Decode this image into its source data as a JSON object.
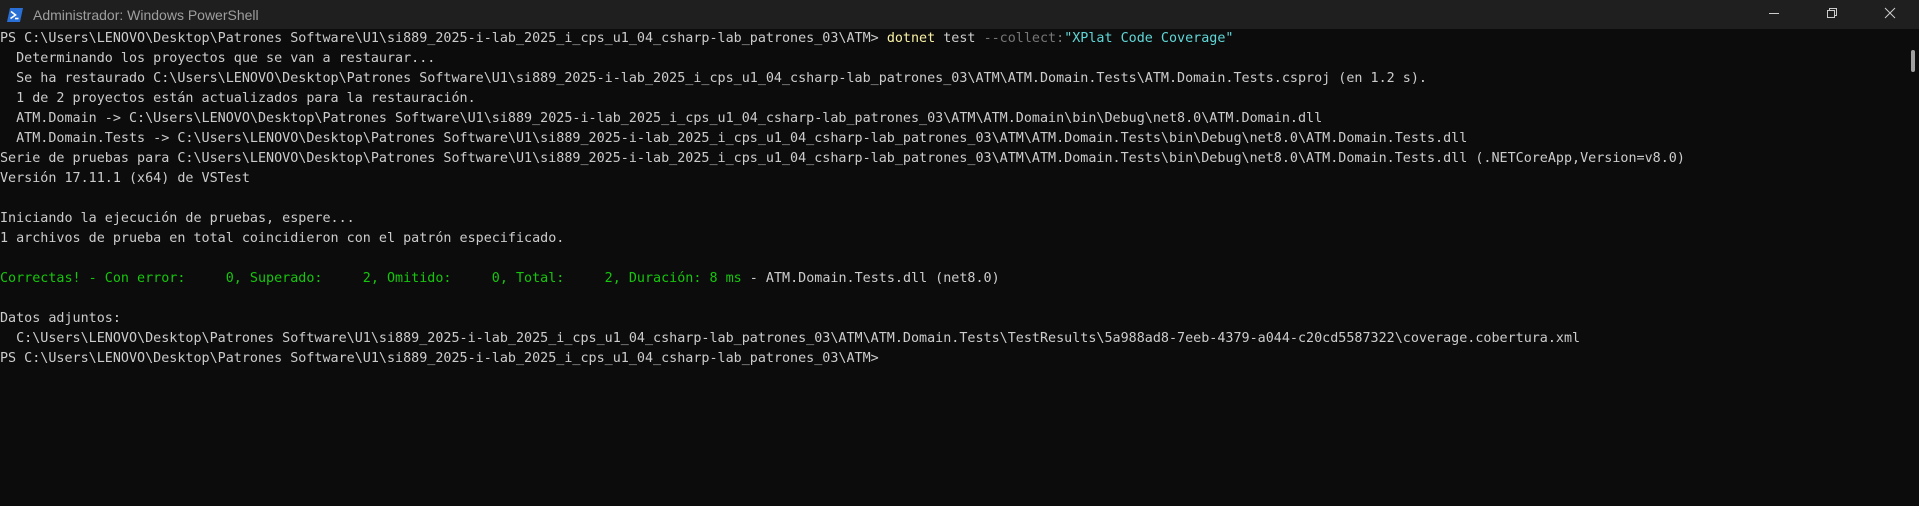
{
  "window": {
    "title": "Administrador: Windows PowerShell",
    "icon": "powershell-icon",
    "controls": [
      "minimize-icon",
      "maximize-icon",
      "close-icon"
    ]
  },
  "colors": {
    "background": "#0c0c0c",
    "text": "#cccccc",
    "command": "#f9f1a5",
    "parameter": "#767676",
    "string": "#61d6d6",
    "success": "#16c60c"
  },
  "terminal": {
    "lines": [
      [
        {
          "text": "PS C:\\Users\\LENOVO\\Desktop\\Patrones Software\\U1\\si889_2025-i-lab_2025_i_cps_u1_04_csharp-lab_patrones_03\\ATM> ",
          "color": "#cccccc"
        },
        {
          "text": "dotnet",
          "color": "#f9f1a5"
        },
        {
          "text": " test ",
          "color": "#cccccc"
        },
        {
          "text": "--collect:",
          "color": "#767676"
        },
        {
          "text": "\"XPlat Code Coverage\"",
          "color": "#61d6d6"
        }
      ],
      [
        {
          "text": "  Determinando los proyectos que se van a restaurar...",
          "color": "#cccccc"
        }
      ],
      [
        {
          "text": "  Se ha restaurado C:\\Users\\LENOVO\\Desktop\\Patrones Software\\U1\\si889_2025-i-lab_2025_i_cps_u1_04_csharp-lab_patrones_03\\ATM\\ATM.Domain.Tests\\ATM.Domain.Tests.csproj (en 1.2 s).",
          "color": "#cccccc"
        }
      ],
      [
        {
          "text": "  1 de 2 proyectos están actualizados para la restauración.",
          "color": "#cccccc"
        }
      ],
      [
        {
          "text": "  ATM.Domain -> C:\\Users\\LENOVO\\Desktop\\Patrones Software\\U1\\si889_2025-i-lab_2025_i_cps_u1_04_csharp-lab_patrones_03\\ATM\\ATM.Domain\\bin\\Debug\\net8.0\\ATM.Domain.dll",
          "color": "#cccccc"
        }
      ],
      [
        {
          "text": "  ATM.Domain.Tests -> C:\\Users\\LENOVO\\Desktop\\Patrones Software\\U1\\si889_2025-i-lab_2025_i_cps_u1_04_csharp-lab_patrones_03\\ATM\\ATM.Domain.Tests\\bin\\Debug\\net8.0\\ATM.Domain.Tests.dll",
          "color": "#cccccc"
        }
      ],
      [
        {
          "text": "Serie de pruebas para C:\\Users\\LENOVO\\Desktop\\Patrones Software\\U1\\si889_2025-i-lab_2025_i_cps_u1_04_csharp-lab_patrones_03\\ATM\\ATM.Domain.Tests\\bin\\Debug\\net8.0\\ATM.Domain.Tests.dll (.NETCoreApp,Version=v8.0)",
          "color": "#cccccc"
        }
      ],
      [
        {
          "text": "Versión 17.11.1 (x64) de VSTest",
          "color": "#cccccc"
        }
      ],
      [
        {
          "text": "",
          "color": "#cccccc"
        }
      ],
      [
        {
          "text": "Iniciando la ejecución de pruebas, espere...",
          "color": "#cccccc"
        }
      ],
      [
        {
          "text": "1 archivos de prueba en total coincidieron con el patrón especificado.",
          "color": "#cccccc"
        }
      ],
      [
        {
          "text": "",
          "color": "#cccccc"
        }
      ],
      [
        {
          "text": "Correctas! - Con error:     0, Superado:     2, Omitido:     0, Total:     2, Duración: 8 ms",
          "color": "#16c60c"
        },
        {
          "text": " - ATM.Domain.Tests.dll (net8.0)",
          "color": "#cccccc"
        }
      ],
      [
        {
          "text": "",
          "color": "#cccccc"
        }
      ],
      [
        {
          "text": "Datos adjuntos:",
          "color": "#cccccc"
        }
      ],
      [
        {
          "text": "  C:\\Users\\LENOVO\\Desktop\\Patrones Software\\U1\\si889_2025-i-lab_2025_i_cps_u1_04_csharp-lab_patrones_03\\ATM\\ATM.Domain.Tests\\TestResults\\5a988ad8-7eeb-4379-a044-c20cd5587322\\coverage.cobertura.xml",
          "color": "#cccccc"
        }
      ],
      [
        {
          "text": "PS C:\\Users\\LENOVO\\Desktop\\Patrones Software\\U1\\si889_2025-i-lab_2025_i_cps_u1_04_csharp-lab_patrones_03\\ATM>",
          "color": "#cccccc"
        }
      ]
    ]
  }
}
